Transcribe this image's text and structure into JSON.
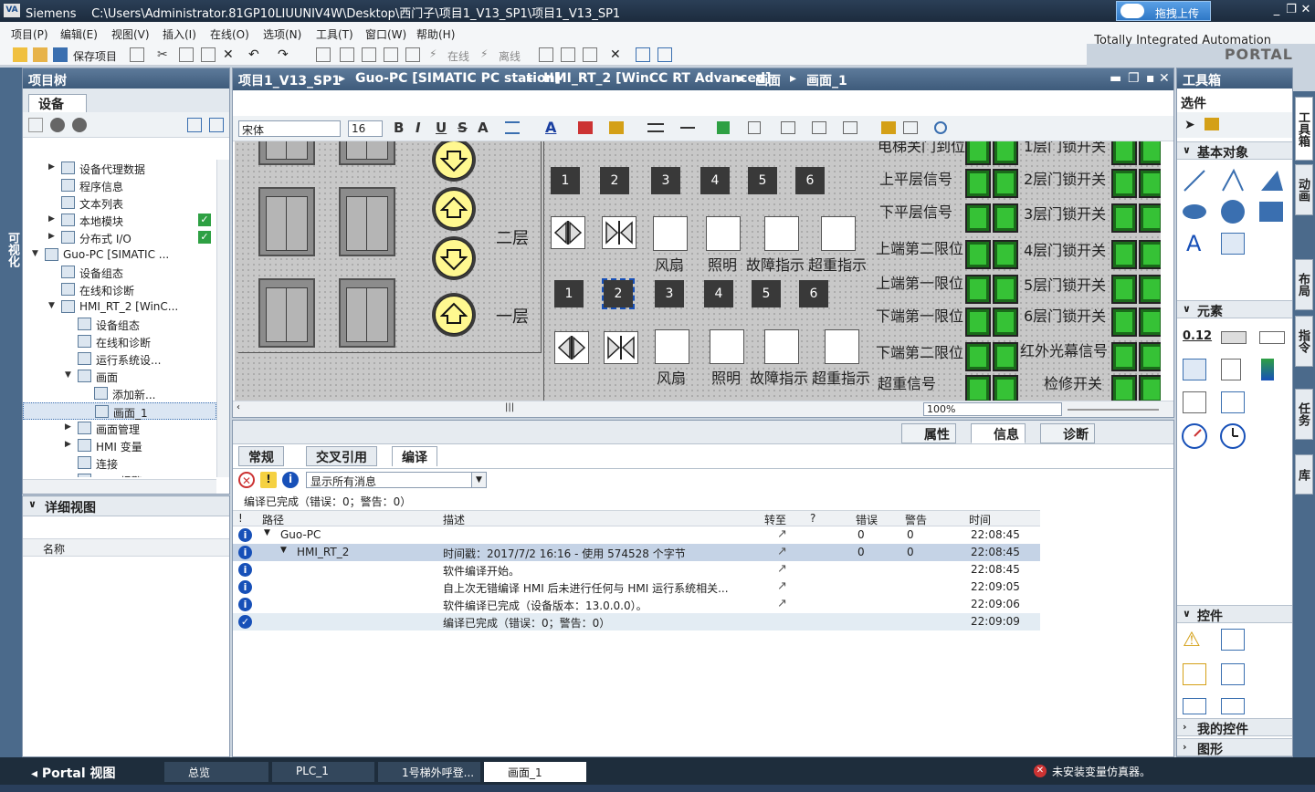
{
  "titlebar": {
    "app": "Siemens",
    "path": "C:\\Users\\Administrator.81GP10LIUUNIV4W\\Desktop\\西门子\\项目1_V13_SP1\\项目1_V13_SP1",
    "upload_label": "拖拽上传"
  },
  "menu": [
    "项目(P)",
    "编辑(E)",
    "视图(V)",
    "插入(I)",
    "在线(O)",
    "选项(N)",
    "工具(T)",
    "窗口(W)",
    "帮助(H)"
  ],
  "brand": {
    "line1": "Totally Integrated Automation",
    "line2": "PORTAL"
  },
  "toolbar": {
    "save_label": "保存项目",
    "online_label": "在线",
    "offline_label": "离线"
  },
  "leftstrip_label": "可视化",
  "project_tree": {
    "title": "项目树",
    "tab": "设备",
    "items": [
      {
        "label": "设备代理数据",
        "indent": 2,
        "expander": "right"
      },
      {
        "label": "程序信息",
        "indent": 2,
        "expander": ""
      },
      {
        "label": "文本列表",
        "indent": 2,
        "expander": ""
      },
      {
        "label": "本地模块",
        "indent": 2,
        "expander": "right",
        "check": true
      },
      {
        "label": "分布式 I/O",
        "indent": 2,
        "expander": "right",
        "check": true
      },
      {
        "label": "Guo-PC [SIMATIC ...",
        "indent": 1,
        "expander": "down"
      },
      {
        "label": "设备组态",
        "indent": 2,
        "expander": ""
      },
      {
        "label": "在线和诊断",
        "indent": 2,
        "expander": ""
      },
      {
        "label": "HMI_RT_2 [WinC...",
        "indent": 2,
        "expander": "down"
      },
      {
        "label": "设备组态",
        "indent": 3,
        "expander": ""
      },
      {
        "label": "在线和诊断",
        "indent": 3,
        "expander": ""
      },
      {
        "label": "运行系统设...",
        "indent": 3,
        "expander": ""
      },
      {
        "label": "画面",
        "indent": 3,
        "expander": "down"
      },
      {
        "label": "添加新...",
        "indent": 4,
        "expander": ""
      },
      {
        "label": "画面_1",
        "indent": 4,
        "expander": "",
        "selected": true
      },
      {
        "label": "画面管理",
        "indent": 3,
        "expander": "right"
      },
      {
        "label": "HMI 变量",
        "indent": 3,
        "expander": "right"
      },
      {
        "label": "连接",
        "indent": 3,
        "expander": ""
      },
      {
        "label": "HMI 报警",
        "indent": 3,
        "expander": ""
      }
    ]
  },
  "detail_view": {
    "title": "详细视图",
    "col_name": "名称"
  },
  "editor": {
    "breadcrumb": [
      "项目1_V13_SP1",
      "Guo-PC [SIMATIC PC station]",
      "HMI_RT_2 [WinCC RT Advanced]",
      "画面",
      "画面_1"
    ],
    "font_name": "宋体",
    "font_size": "16",
    "zoom": "100%",
    "canvas": {
      "floor2": "二层",
      "floor1": "一层",
      "numbers": [
        "1",
        "2",
        "3",
        "4",
        "5",
        "6"
      ],
      "indicators": [
        "风扇",
        "照明",
        "故障指示",
        "超重指示"
      ],
      "signals_left": [
        "电梯关门到位",
        "上平层信号",
        "下平层信号",
        "上端第二限位",
        "上端第一限位",
        "下端第一限位",
        "下端第二限位",
        "超重信号"
      ],
      "signals_right": [
        "1层门锁开关",
        "2层门锁开关",
        "3层门锁开关",
        "4层门锁开关",
        "5层门锁开关",
        "6层门锁开关",
        "红外光幕信号",
        "检修开关"
      ]
    }
  },
  "toolbox": {
    "title": "工具箱",
    "options": "选件",
    "sections": {
      "basic": "基本对象",
      "elements": "元素",
      "controls": "控件",
      "my_controls": "我的控件",
      "graphics": "图形"
    },
    "element_value": "0.12"
  },
  "right_tabs": [
    "工具箱",
    "动画",
    "布局",
    "指令",
    "任务",
    "库"
  ],
  "inspector": {
    "tabs": [
      "属性",
      "信息",
      "诊断"
    ],
    "subtabs": [
      "常规",
      "交叉引用",
      "编译"
    ],
    "filter": "显示所有消息",
    "summary": "编译已完成（错误：0；警告：0）",
    "columns": [
      "!",
      "路径",
      "描述",
      "转至",
      "?",
      "错误",
      "警告",
      "时间"
    ],
    "rows": [
      {
        "path": "Guo-PC",
        "desc": "",
        "errors": "0",
        "warnings": "0",
        "time": "22:08:45",
        "level": 1,
        "goto": true
      },
      {
        "path": "HMI_RT_2",
        "desc": "时间戳：2017/7/2 16:16 - 使用 574528 个字节",
        "errors": "0",
        "warnings": "0",
        "time": "22:08:45",
        "level": 2,
        "goto": true,
        "selected": true
      },
      {
        "path": "",
        "desc": "软件编译开始。",
        "errors": "",
        "warnings": "",
        "time": "22:08:45",
        "goto": true
      },
      {
        "path": "",
        "desc": "自上次无错编译 HMI 后未进行任何与 HMI 运行系统相关...",
        "errors": "",
        "warnings": "",
        "time": "22:09:05",
        "goto": true
      },
      {
        "path": "",
        "desc": "软件编译已完成（设备版本：13.0.0.0）。",
        "errors": "",
        "warnings": "",
        "time": "22:09:06",
        "goto": true
      },
      {
        "path": "",
        "desc": "编译已完成（错误：0；警告：0）",
        "errors": "",
        "warnings": "",
        "time": "22:09:09",
        "goto": false,
        "done": true
      }
    ]
  },
  "taskbar": {
    "portal": "Portal 视图",
    "items": [
      "总览",
      "PLC_1",
      "1号梯外呼登...",
      "画面_1"
    ],
    "status": "未安装变量仿真器。"
  },
  "colors": {
    "header": "#3e5b7b",
    "accent": "#2ea043",
    "info": "#1750b8"
  }
}
